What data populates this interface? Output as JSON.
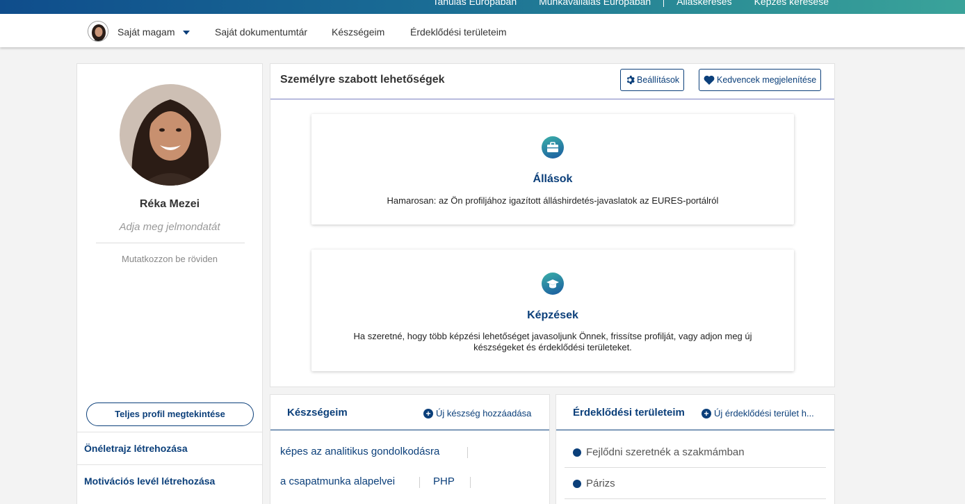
{
  "topbar": {
    "links": [
      "Tanulás Európában",
      "Munkavállalás Európában",
      "Álláskeresés",
      "Képzés keresése"
    ]
  },
  "nav": {
    "user_label": "Saját magam",
    "items": [
      "Saját dokumentumtár",
      "Készségeim",
      "Érdeklődési területeim"
    ]
  },
  "profile": {
    "name": "Réka Mezei",
    "motto_placeholder": "Adja meg jelmondatát",
    "intro_placeholder": "Mutatkozzon be röviden",
    "full_profile_button": "Teljes profil megtekintése",
    "links": [
      "Önéletrajz létrehozása",
      "Motivációs levél létrehozása"
    ]
  },
  "opportunities": {
    "title": "Személyre szabott lehetőségek",
    "settings_button": "Beállítások",
    "favorites_button": "Kedvencek megjelenítése",
    "jobs": {
      "title": "Állások",
      "description": "Hamarosan: az Ön profiljához igazított álláshirdetés-javaslatok az EURES-portálról"
    },
    "trainings": {
      "title": "Képzések",
      "description": "Ha szeretné, hogy több képzési lehetőséget javasoljunk Önnek, frissítse profilját, vagy adjon meg új készségeket és érdeklődési területeket."
    }
  },
  "skills": {
    "title": "Készségeim",
    "add_label": "Új készség hozzáadása",
    "items": [
      "képes az analitikus gondolkodásra",
      "a csapatmunka alapelvei",
      "PHP"
    ]
  },
  "interests": {
    "title": "Érdeklődési területeim",
    "add_label": "Új érdeklődési terület h...",
    "items": [
      "Fejlődni szeretnék a szakmámban",
      "Párizs"
    ]
  },
  "colors": {
    "primary": "#0b3f7a",
    "topbar_start": "#0f4d8c",
    "topbar_end": "#3aa39a",
    "background": "#f3f3f3"
  },
  "icons": [
    "user-avatar-icon",
    "caret-down-icon",
    "gear-icon",
    "heart-icon",
    "briefcase-icon",
    "graduation-cap-icon",
    "plus-circle-icon"
  ]
}
